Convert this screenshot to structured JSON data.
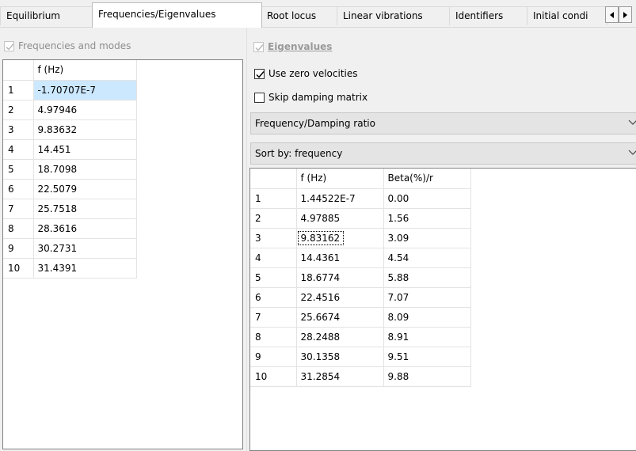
{
  "tabs": [
    {
      "label": "Equilibrium",
      "active": false
    },
    {
      "label": "Frequencies/Eigenvalues",
      "active": true
    },
    {
      "label": "Root locus",
      "active": false
    },
    {
      "label": "Linear vibrations",
      "active": false
    },
    {
      "label": "Identifiers",
      "active": false
    },
    {
      "label": "Initial condi",
      "active": false
    }
  ],
  "left": {
    "checkbox_label": "Frequencies and modes",
    "checkbox_checked": true,
    "header": "f (Hz)",
    "rows": [
      {
        "n": "1",
        "f": "-1.70707E-7"
      },
      {
        "n": "2",
        "f": "4.97946"
      },
      {
        "n": "3",
        "f": "9.83632"
      },
      {
        "n": "4",
        "f": "14.451"
      },
      {
        "n": "5",
        "f": "18.7098"
      },
      {
        "n": "6",
        "f": "22.5079"
      },
      {
        "n": "7",
        "f": "25.7518"
      },
      {
        "n": "8",
        "f": "28.3616"
      },
      {
        "n": "9",
        "f": "30.2731"
      },
      {
        "n": "10",
        "f": "31.4391"
      }
    ]
  },
  "right": {
    "eigen_label": "Eigenvalues",
    "use_zero_velocities": "Use zero velocities",
    "skip_damping_matrix": "Skip damping matrix",
    "mode_select": "Frequency/Damping ratio",
    "sort_select": "Sort by: frequency",
    "headers": [
      "f (Hz)",
      "Beta(%)/r"
    ],
    "rows": [
      {
        "n": "1",
        "f": "1.44522E-7",
        "beta": "0.00"
      },
      {
        "n": "2",
        "f": "4.97885",
        "beta": "1.56"
      },
      {
        "n": "3",
        "f": "9.83162",
        "beta": "3.09"
      },
      {
        "n": "4",
        "f": "14.4361",
        "beta": "4.54"
      },
      {
        "n": "5",
        "f": "18.6774",
        "beta": "5.88"
      },
      {
        "n": "6",
        "f": "22.4516",
        "beta": "7.07"
      },
      {
        "n": "7",
        "f": "25.6674",
        "beta": "8.09"
      },
      {
        "n": "8",
        "f": "28.2488",
        "beta": "8.91"
      },
      {
        "n": "9",
        "f": "30.1358",
        "beta": "9.51"
      },
      {
        "n": "10",
        "f": "31.2854",
        "beta": "9.88"
      }
    ]
  },
  "colors": {
    "selection": "#cce8ff",
    "disabled_text": "#8d8d8d"
  }
}
